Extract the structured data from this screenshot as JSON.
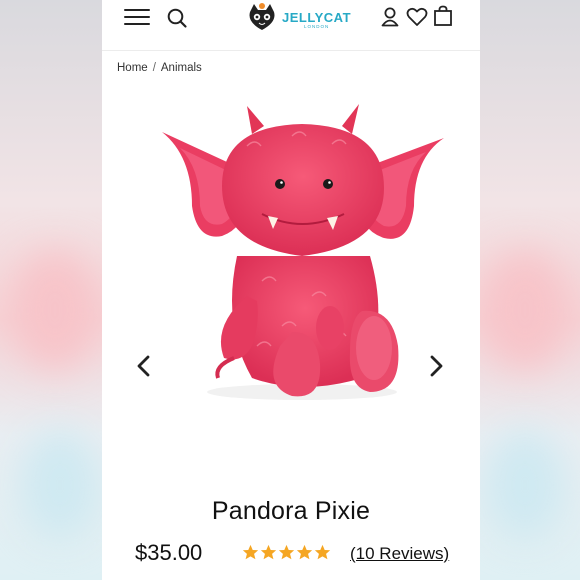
{
  "header": {
    "menu_icon": "hamburger-icon",
    "search_icon": "search-icon",
    "logo_text": "JELLYCAT",
    "logo_sub": "LONDON",
    "account_icon": "user-icon",
    "wishlist_icon": "heart-icon",
    "bag_icon": "shopping-bag-icon"
  },
  "breadcrumb": {
    "home": "Home",
    "separator": "/",
    "current": "Animals"
  },
  "product": {
    "name": "Pandora Pixie",
    "price": "$35.00",
    "rating": 5,
    "rating_max": 5,
    "reviews_label": "(10 Reviews)",
    "star_color": "#f5a623"
  },
  "gallery": {
    "prev_icon": "chevron-left-icon",
    "next_icon": "chevron-right-icon",
    "image_icon": "pink-monster-plush-image"
  },
  "colors": {
    "brand": "#27a9c6",
    "plush": "#ee3f63"
  }
}
